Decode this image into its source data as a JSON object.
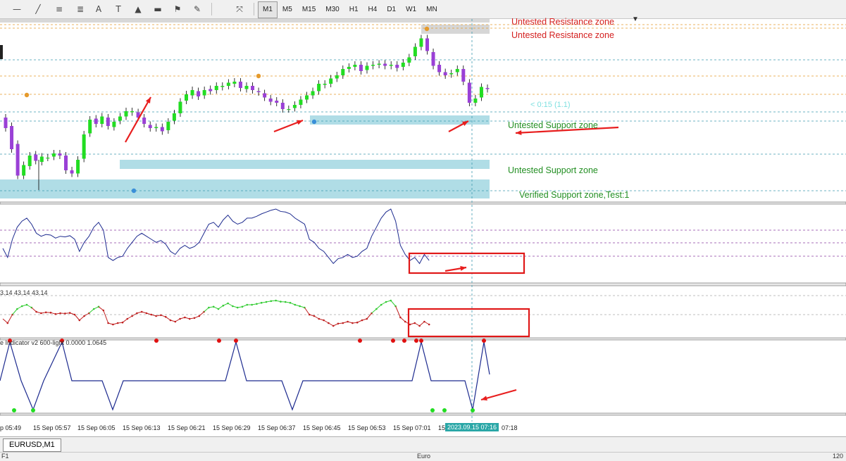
{
  "toolbar": {
    "tools": [
      {
        "icon": "minus-icon",
        "glyph": "—"
      },
      {
        "icon": "trendline-icon",
        "glyph": "╱"
      },
      {
        "icon": "equidistant-channel-icon",
        "glyph": "≡"
      },
      {
        "icon": "fibonacci-icon",
        "glyph": "≣"
      },
      {
        "icon": "text-icon",
        "glyph": "A"
      },
      {
        "icon": "text-label-icon",
        "glyph": "T"
      },
      {
        "icon": "triangle-icon",
        "glyph": "▲"
      },
      {
        "icon": "rectangle-icon",
        "glyph": "▬"
      },
      {
        "icon": "flag-icon",
        "glyph": "⚑"
      },
      {
        "icon": "pencil-icon",
        "glyph": "✎"
      },
      {
        "icon": "arrows-icon",
        "glyph": "⤧"
      }
    ],
    "timeframes": [
      "M1",
      "M5",
      "M15",
      "M30",
      "H1",
      "H4",
      "D1",
      "W1",
      "MN"
    ],
    "active_timeframe": "M1"
  },
  "zones": {
    "resistance_1": "Untested Resistance zone",
    "resistance_2": "Untested Resistance zone",
    "support_1": "Untested Support zone",
    "support_2": "Untested Support zone",
    "verified": "Verified Support zone,Test:1",
    "countdown": "< 0:15 (1.1)"
  },
  "indicator_labels": {
    "pane3": "3.14 43.14 43.14",
    "pane4": "e Indicator v2 600-light 0.0000 1.0645"
  },
  "time_axis": {
    "labels": [
      "p 05:49",
      "15 Sep 05:57",
      "15 Sep 06:05",
      "15 Sep 06:13",
      "15 Sep 06:21",
      "15 Sep 06:29",
      "15 Sep 06:37",
      "15 Sep 06:45",
      "15 Sep 06:53",
      "15 Sep 07:01",
      "15",
      "07:18"
    ],
    "cursor": "2023.09.15 07:16"
  },
  "tabs": {
    "active": "EURUSD,M1"
  },
  "status": {
    "left": "F1",
    "center": "Euro",
    "right": "120"
  },
  "colors": {
    "bull": "#22dd22",
    "bear": "#9a40d6",
    "zone": "#b0dde6",
    "resistance_text": "#d42020",
    "support_text": "#238f23",
    "arrow": "#e81e1e"
  },
  "chart_data": {
    "type": "candlestick",
    "candles": [
      {
        "o": 0.7,
        "c": 0.6
      },
      {
        "o": 0.62,
        "c": 0.4
      },
      {
        "o": 0.45,
        "c": 0.15
      },
      {
        "o": 0.15,
        "c": 0.25
      },
      {
        "o": 0.24,
        "c": 0.34
      },
      {
        "o": 0.35,
        "c": 0.29
      },
      {
        "o": 0.28,
        "c": 0.33
      },
      {
        "o": 0.32,
        "c": 0.32
      },
      {
        "o": 0.33,
        "c": 0.36
      },
      {
        "o": 0.36,
        "c": 0.34
      },
      {
        "o": 0.34,
        "c": 0.2
      },
      {
        "o": 0.2,
        "c": 0.17
      },
      {
        "o": 0.17,
        "c": 0.3
      },
      {
        "o": 0.31,
        "c": 0.54
      },
      {
        "o": 0.55,
        "c": 0.68
      },
      {
        "o": 0.69,
        "c": 0.64
      },
      {
        "o": 0.64,
        "c": 0.71
      },
      {
        "o": 0.7,
        "c": 0.62
      },
      {
        "o": 0.61,
        "c": 0.66
      },
      {
        "o": 0.67,
        "c": 0.71
      },
      {
        "o": 0.71,
        "c": 0.76
      },
      {
        "o": 0.75,
        "c": 0.76
      },
      {
        "o": 0.75,
        "c": 0.7
      },
      {
        "o": 0.7,
        "c": 0.64
      },
      {
        "o": 0.63,
        "c": 0.6
      },
      {
        "o": 0.6,
        "c": 0.61
      },
      {
        "o": 0.61,
        "c": 0.57
      },
      {
        "o": 0.58,
        "c": 0.66
      },
      {
        "o": 0.67,
        "c": 0.74
      },
      {
        "o": 0.74,
        "c": 0.85
      },
      {
        "o": 0.86,
        "c": 0.92
      },
      {
        "o": 0.91,
        "c": 0.96
      },
      {
        "o": 0.95,
        "c": 0.9
      },
      {
        "o": 0.91,
        "c": 0.96
      },
      {
        "o": 0.97,
        "c": 0.95
      },
      {
        "o": 0.96,
        "c": 1.0
      },
      {
        "o": 0.99,
        "c": 1.0
      },
      {
        "o": 1.0,
        "c": 1.03
      },
      {
        "o": 1.02,
        "c": 1.04
      },
      {
        "o": 1.04,
        "c": 0.98
      },
      {
        "o": 0.97,
        "c": 1.0
      },
      {
        "o": 1.0,
        "c": 0.96
      },
      {
        "o": 0.95,
        "c": 0.94
      },
      {
        "o": 0.93,
        "c": 0.89
      },
      {
        "o": 0.88,
        "c": 0.85
      },
      {
        "o": 0.86,
        "c": 0.84
      },
      {
        "o": 0.84,
        "c": 0.78
      },
      {
        "o": 0.78,
        "c": 0.78
      },
      {
        "o": 0.79,
        "c": 0.82
      },
      {
        "o": 0.82,
        "c": 0.87
      },
      {
        "o": 0.87,
        "c": 0.91
      },
      {
        "o": 0.91,
        "c": 0.95
      },
      {
        "o": 0.95,
        "c": 1.02
      },
      {
        "o": 1.01,
        "c": 1.02
      },
      {
        "o": 1.02,
        "c": 1.07
      },
      {
        "o": 1.07,
        "c": 1.1
      },
      {
        "o": 1.1,
        "c": 1.16
      },
      {
        "o": 1.16,
        "c": 1.18
      },
      {
        "o": 1.18,
        "c": 1.2
      },
      {
        "o": 1.2,
        "c": 1.14
      },
      {
        "o": 1.15,
        "c": 1.19
      },
      {
        "o": 1.19,
        "c": 1.2
      },
      {
        "o": 1.2,
        "c": 1.21
      },
      {
        "o": 1.21,
        "c": 1.19
      },
      {
        "o": 1.19,
        "c": 1.2
      },
      {
        "o": 1.2,
        "c": 1.17
      },
      {
        "o": 1.18,
        "c": 1.22
      },
      {
        "o": 1.22,
        "c": 1.27
      },
      {
        "o": 1.28,
        "c": 1.37
      },
      {
        "o": 1.37,
        "c": 1.45
      },
      {
        "o": 1.45,
        "c": 1.33
      },
      {
        "o": 1.32,
        "c": 1.19
      },
      {
        "o": 1.2,
        "c": 1.13
      },
      {
        "o": 1.13,
        "c": 1.1
      },
      {
        "o": 1.11,
        "c": 1.12
      },
      {
        "o": 1.13,
        "c": 1.16
      },
      {
        "o": 1.16,
        "c": 1.04
      },
      {
        "o": 1.03,
        "c": 0.84
      },
      {
        "o": 0.84,
        "c": 0.88
      },
      {
        "o": 0.89,
        "c": 0.99
      },
      {
        "o": 0.98,
        "c": 0.97
      }
    ],
    "oscillator": [
      0.35,
      0.2,
      0.5,
      0.7,
      0.8,
      0.85,
      0.75,
      0.6,
      0.55,
      0.58,
      0.57,
      0.52,
      0.55,
      0.54,
      0.56,
      0.5,
      0.3,
      0.45,
      0.55,
      0.7,
      0.78,
      0.65,
      0.2,
      0.15,
      0.2,
      0.22,
      0.35,
      0.45,
      0.55,
      0.6,
      0.55,
      0.5,
      0.45,
      0.48,
      0.42,
      0.3,
      0.25,
      0.35,
      0.4,
      0.35,
      0.38,
      0.45,
      0.6,
      0.75,
      0.78,
      0.7,
      0.82,
      0.9,
      0.8,
      0.75,
      0.78,
      0.85,
      0.85,
      0.88,
      0.92,
      0.95,
      0.98,
      1.0,
      0.96,
      0.95,
      0.92,
      0.85,
      0.8,
      0.75,
      0.5,
      0.45,
      0.35,
      0.3,
      0.2,
      0.1,
      0.18,
      0.2,
      0.25,
      0.2,
      0.22,
      0.3,
      0.35,
      0.55,
      0.7,
      0.85,
      0.95,
      1.0,
      0.8,
      0.4,
      0.25,
      0.15,
      0.2,
      0.1,
      0.25,
      0.15
    ]
  }
}
